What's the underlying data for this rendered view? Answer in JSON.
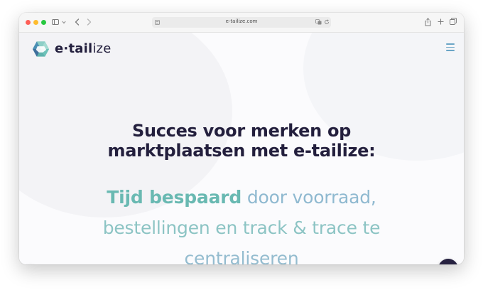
{
  "browser": {
    "url": "e-tailize.com",
    "icons": {
      "back": "chevron-left-icon",
      "forward": "chevron-right-icon",
      "sidebar": "sidebar-icon",
      "share": "share-icon",
      "new_tab": "plus-icon",
      "tabs": "tabs-overview-icon",
      "reload": "reload-icon",
      "translate": "translate-icon",
      "reader": "reader-icon"
    }
  },
  "site": {
    "logo": {
      "bold": "e·tail",
      "light": "ize"
    },
    "hero": {
      "headline_line1": "Succes voor merken op",
      "headline_line2": "marktplaatsen met e-tailize:",
      "highlight": "Tijd bespaard",
      "sub_part1": " door voorraad,",
      "sub_line2": "bestellingen en track & trace te",
      "sub_line3": "centraliseren"
    },
    "icons": {
      "menu": "hamburger-menu-icon",
      "cookie": "cookie-settings-icon",
      "chat": "chat-icon"
    }
  },
  "colors": {
    "brand_dark": "#231f3d",
    "brand_teal": "#69b9b2",
    "brand_blue": "#8fb9d0",
    "menu": "#6aa5c6"
  }
}
